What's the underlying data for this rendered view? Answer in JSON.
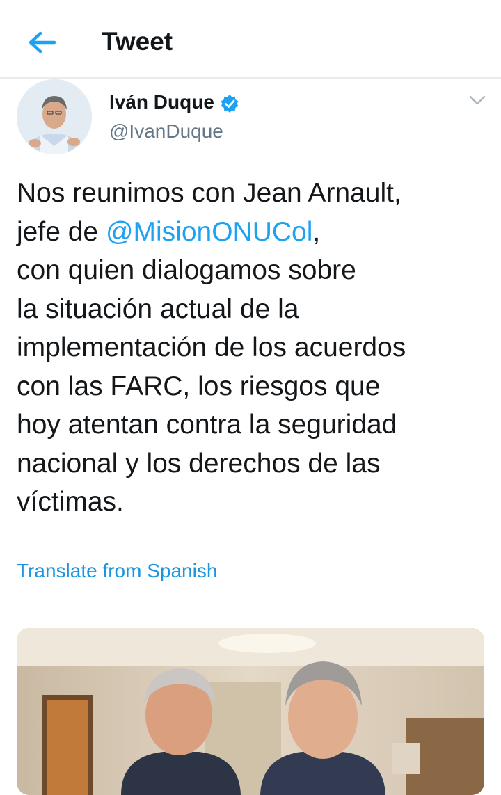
{
  "header": {
    "title": "Tweet",
    "back_icon": "arrow-left-icon"
  },
  "author": {
    "name": "Iván Duque",
    "handle": "@IvanDuque",
    "verified": true
  },
  "tweet": {
    "lines": [
      "Nos reunimos con Jean Arnault,",
      "jefe de ",
      "con quien dialogamos sobre",
      "la situación actual de la",
      "implementación de los acuerdos",
      "con las FARC, los riesgos que",
      "hoy atentan contra la seguridad",
      "nacional y los derechos de las",
      "víctimas."
    ],
    "mention": "@MisionONUCol",
    "mention_suffix": ","
  },
  "translate_link": "Translate from Spanish",
  "colors": {
    "accent": "#1da1f2",
    "text": "#14171a",
    "secondary": "#657786"
  }
}
